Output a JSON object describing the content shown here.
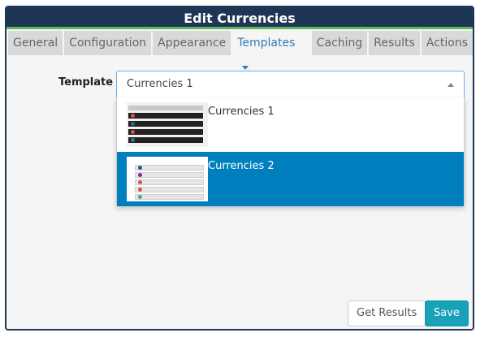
{
  "dialog": {
    "title": "Edit Currencies"
  },
  "tabs": [
    {
      "label": "General",
      "active": false
    },
    {
      "label": "Configuration",
      "active": false
    },
    {
      "label": "Appearance",
      "active": false
    },
    {
      "label": "Templates",
      "active": true
    },
    {
      "label": "Caching",
      "active": false
    },
    {
      "label": "Results",
      "active": false
    },
    {
      "label": "Actions",
      "active": false
    }
  ],
  "template_field": {
    "label": "Template",
    "selected_value": "Currencies 1",
    "options": [
      {
        "label": "Currencies 1",
        "highlighted": false
      },
      {
        "label": "Currencies 2",
        "highlighted": true
      }
    ]
  },
  "footer": {
    "get_results_label": "Get Results",
    "save_label": "Save"
  },
  "colors": {
    "header": "#1f3556",
    "accent": "#5cb85c",
    "highlight": "#007fbf",
    "save": "#17a2b8"
  }
}
